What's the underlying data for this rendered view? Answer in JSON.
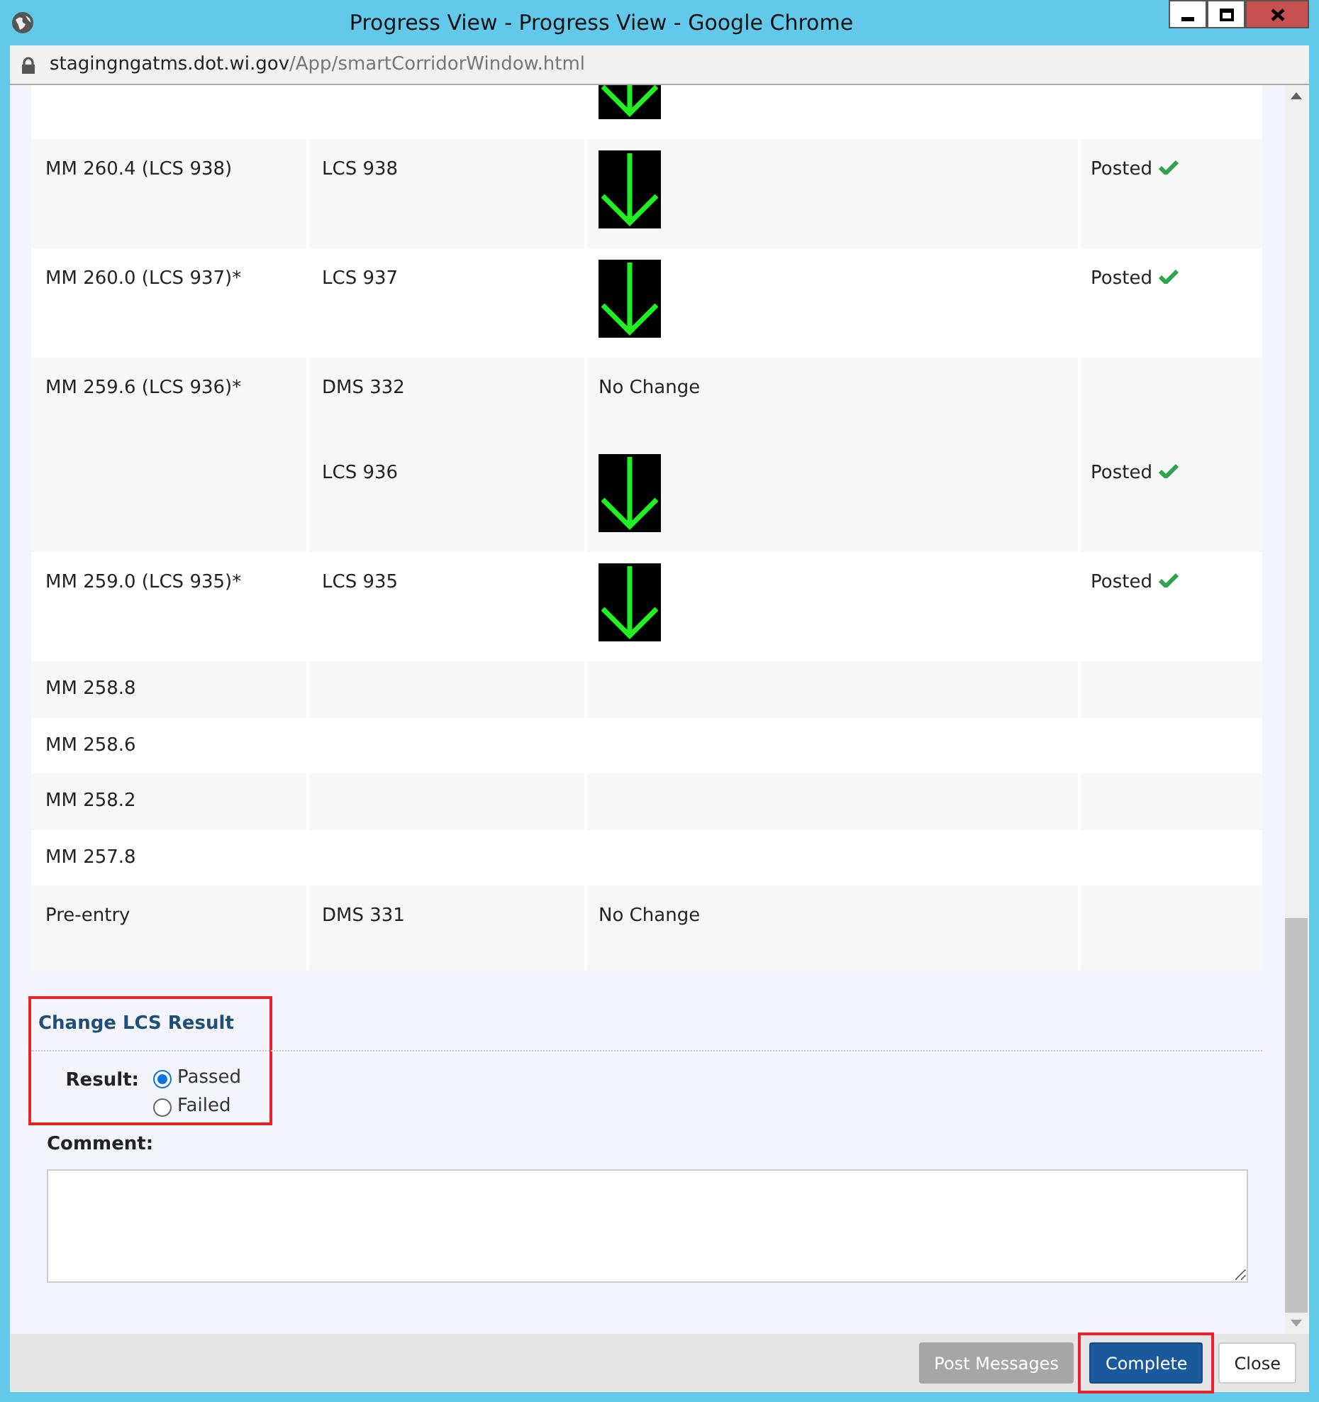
{
  "window": {
    "title": "Progress View - Progress View - Google Chrome",
    "url_host": "stagingngatms.dot.wi.gov",
    "url_path": "/App/smartCorridorWindow.html"
  },
  "table": {
    "rows": [
      {
        "entries": [
          {
            "message": {
              "kind": "arrow"
            }
          }
        ]
      },
      {
        "location": "MM 260.4 (LCS 938)",
        "entries": [
          {
            "device": "LCS 938",
            "message": {
              "kind": "arrow"
            },
            "status": {
              "text": "Posted",
              "ok": true
            }
          }
        ]
      },
      {
        "location": "MM 260.0 (LCS 937)*",
        "entries": [
          {
            "device": "LCS 937",
            "message": {
              "kind": "arrow"
            },
            "status": {
              "text": "Posted",
              "ok": true
            }
          }
        ]
      },
      {
        "location": "MM 259.6 (LCS 936)*",
        "entries": [
          {
            "device": "DMS 332",
            "message": {
              "kind": "text",
              "text": "No Change"
            }
          },
          {
            "device": "LCS 936",
            "message": {
              "kind": "arrow"
            },
            "status": {
              "text": "Posted",
              "ok": true
            }
          }
        ]
      },
      {
        "location": "MM 259.0 (LCS 935)*",
        "entries": [
          {
            "device": "LCS 935",
            "message": {
              "kind": "arrow"
            },
            "status": {
              "text": "Posted",
              "ok": true
            }
          }
        ]
      },
      {
        "location": "MM 258.8",
        "entries": []
      },
      {
        "location": "MM 258.6",
        "entries": []
      },
      {
        "location": "MM 258.2",
        "entries": []
      },
      {
        "location": "MM 257.8",
        "entries": []
      },
      {
        "location": "Pre-entry",
        "entries": [
          {
            "device": "DMS 331",
            "message": {
              "kind": "text",
              "text": "No Change"
            }
          }
        ]
      }
    ]
  },
  "result_section": {
    "title": "Change LCS Result",
    "highlighted": true,
    "label": "Result:",
    "options": [
      {
        "label": "Passed",
        "selected": true
      },
      {
        "label": "Failed",
        "selected": false
      }
    ]
  },
  "comment": {
    "label": "Comment:"
  },
  "buttons": [
    {
      "label": "Post Messages",
      "disabled": true,
      "primary": false,
      "highlighted": false
    },
    {
      "label": "Complete",
      "disabled": false,
      "primary": true,
      "highlighted": true
    },
    {
      "label": "Close",
      "disabled": false,
      "primary": false,
      "highlighted": false
    }
  ]
}
